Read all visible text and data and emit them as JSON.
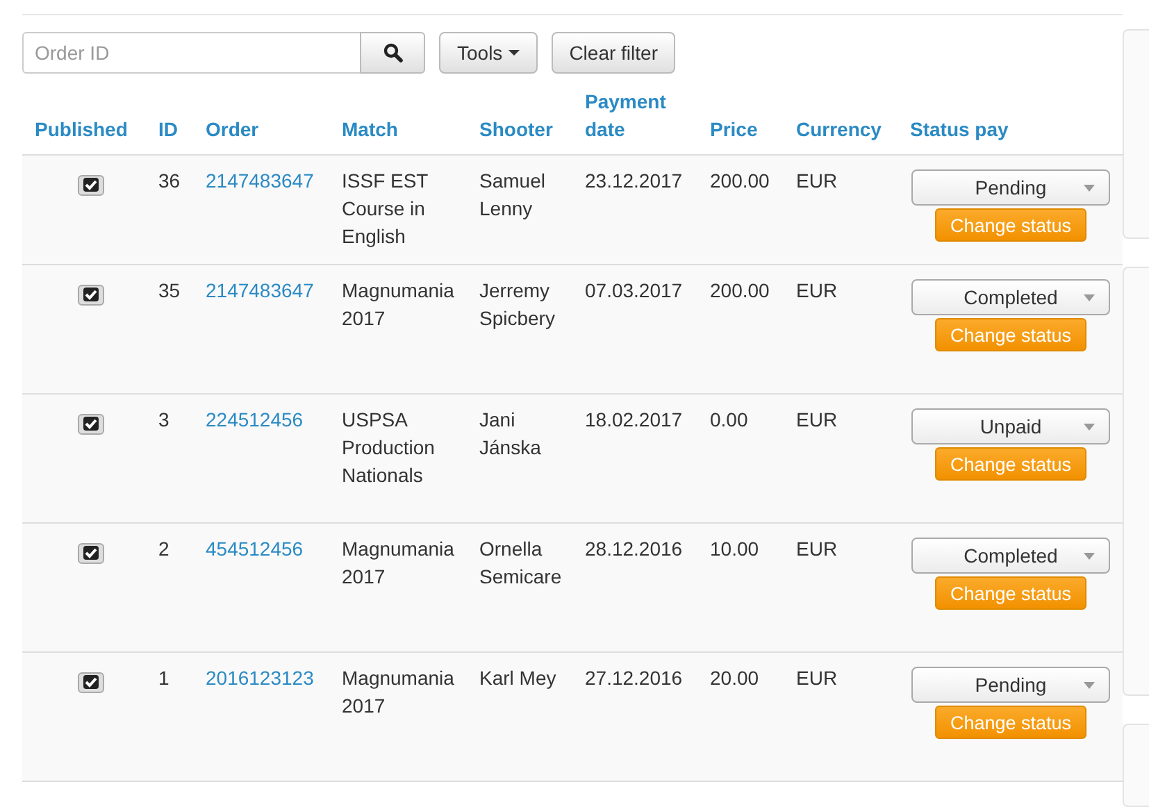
{
  "toolbar": {
    "search": {
      "placeholder": "Order ID"
    },
    "tools_button": "Tools",
    "clear_button": "Clear filter"
  },
  "table": {
    "columns": [
      "Published",
      "ID",
      "Order",
      "Match",
      "Shooter",
      "Payment date",
      "Price",
      "Currency",
      "Status pay"
    ],
    "rows": [
      {
        "published": true,
        "id": "36",
        "order": "2147483647",
        "match": "ISSF EST Course in English",
        "shooter": "Samuel Lenny",
        "payment_date": "23.12.2017",
        "price": "200.00",
        "currency": "EUR",
        "status": "Pending",
        "action": "Change status"
      },
      {
        "published": true,
        "id": "35",
        "order": "2147483647",
        "match": "Magnumania 2017",
        "shooter": "Jerremy Spicbery",
        "payment_date": "07.03.2017",
        "price": "200.00",
        "currency": "EUR",
        "status": "Completed",
        "action": "Change status"
      },
      {
        "published": true,
        "id": "3",
        "order": "224512456",
        "match": "USPSA Production Nationals",
        "shooter": "Jani Jánska",
        "payment_date": "18.02.2017",
        "price": "0.00",
        "currency": "EUR",
        "status": "Unpaid",
        "action": "Change status"
      },
      {
        "published": true,
        "id": "2",
        "order": "454512456",
        "match": "Magnumania 2017",
        "shooter": "Ornella Semicare",
        "payment_date": "28.12.2016",
        "price": "10.00",
        "currency": "EUR",
        "status": "Completed",
        "action": "Change status"
      },
      {
        "published": true,
        "id": "1",
        "order": "2016123123",
        "match": "Magnumania 2017",
        "shooter": "Karl Mey",
        "payment_date": "27.12.2016",
        "price": "20.00",
        "currency": "EUR",
        "status": "Pending",
        "action": "Change status"
      }
    ]
  }
}
